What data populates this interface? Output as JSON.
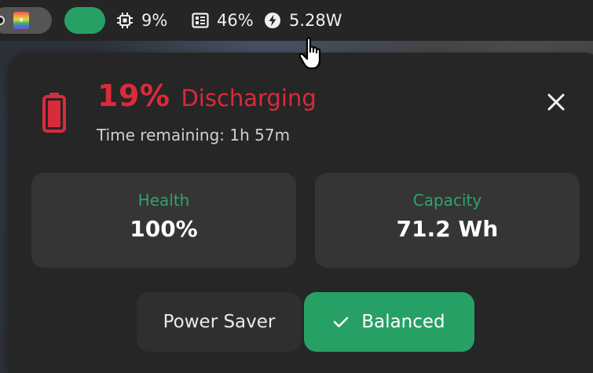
{
  "topbar": {
    "cpu": {
      "icon": "cpu-icon",
      "value": "9%"
    },
    "memory": {
      "icon": "memory-icon",
      "value": "46%"
    },
    "power": {
      "icon": "lightning-icon",
      "value": "5.28W"
    }
  },
  "battery": {
    "percent": "19%",
    "status": "Discharging",
    "time_remaining": "Time remaining: 1h 57m",
    "status_color": "#d92b3a"
  },
  "cards": {
    "health": {
      "label": "Health",
      "value": "100%"
    },
    "capacity": {
      "label": "Capacity",
      "value": "71.2 Wh"
    }
  },
  "power_modes": {
    "saver_label": "Power Saver",
    "balanced_label": "Balanced",
    "selected": "Balanced"
  },
  "colors": {
    "accent": "#27a065",
    "panel_bg": "#262626",
    "card_bg": "#353535"
  }
}
